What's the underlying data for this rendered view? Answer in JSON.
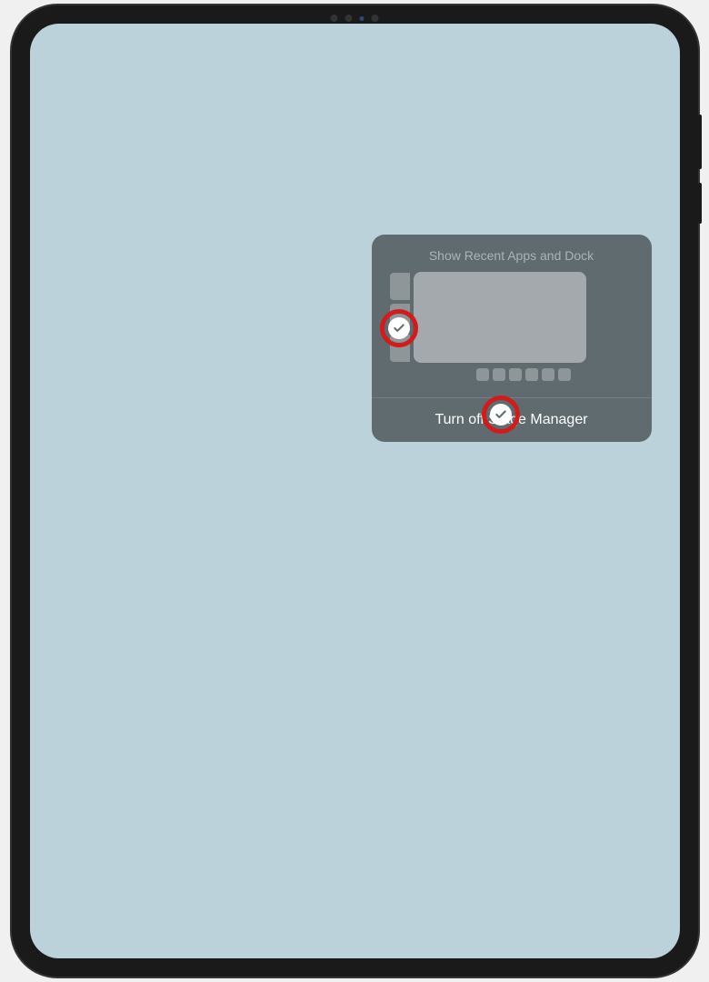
{
  "popup": {
    "header": "Show Recent Apps and Dock",
    "action": "Turn off Stage Manager"
  },
  "toggles": {
    "recent_apps_checked": true,
    "dock_checked": true
  },
  "annotations": {
    "highlight_color": "#d21c1c"
  }
}
